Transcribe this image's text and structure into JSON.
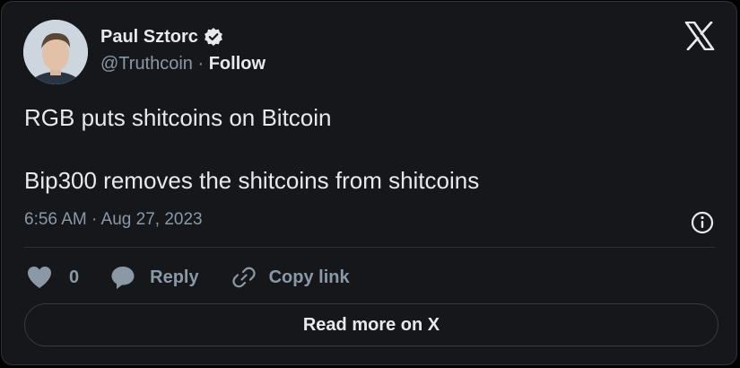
{
  "author": {
    "name": "Paul Sztorc",
    "handle": "@Truthcoin",
    "separator": " · ",
    "follow_label": "Follow",
    "verified_icon": "verified-badge-icon"
  },
  "tweet": {
    "line1": "RGB puts shitcoins on Bitcoin",
    "line2": "Bip300 removes the shitcoins from shitcoins",
    "timestamp": "6:56 AM · Aug 27, 2023"
  },
  "actions": {
    "like_count": "0",
    "reply_label": "Reply",
    "copy_label": "Copy link"
  },
  "read_more_label": "Read more on X",
  "colors": {
    "background": "#15171b",
    "text": "#e7e9ea",
    "muted": "#8b98a5",
    "border": "#2f3336"
  }
}
